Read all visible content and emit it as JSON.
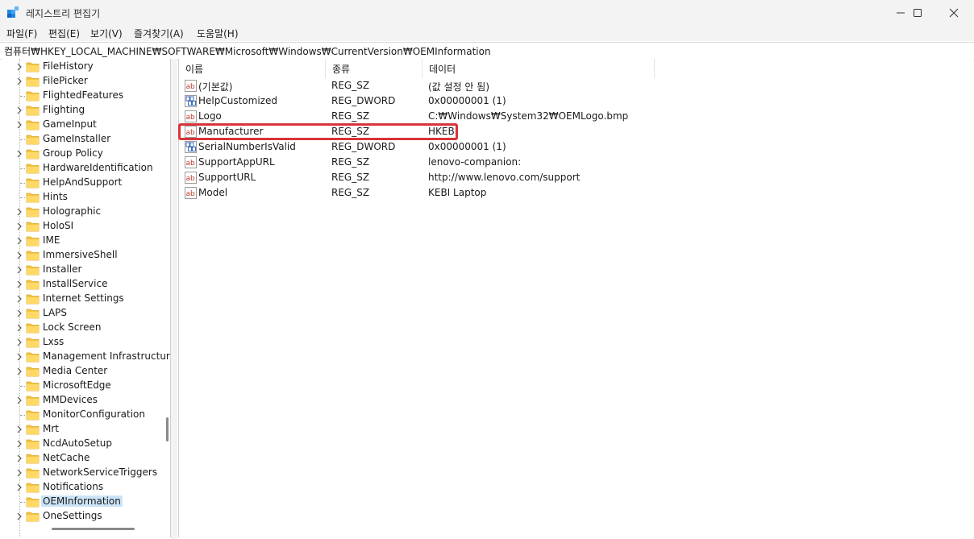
{
  "window": {
    "title": "레지스트리 편집기",
    "minimize_icon": "minimize-icon",
    "maximize_icon": "maximize-icon",
    "close_icon": "close-icon"
  },
  "menu": {
    "items": [
      "파일(F)",
      "편집(E)",
      "보기(V)",
      "즐겨찾기(A)",
      "도움말(H)"
    ]
  },
  "address": {
    "path": "컴퓨터₩HKEY_LOCAL_MACHINE₩SOFTWARE₩Microsoft₩Windows₩CurrentVersion₩OEMInformation"
  },
  "tree": {
    "items": [
      {
        "label": "FileHistory",
        "expandable": true
      },
      {
        "label": "FilePicker",
        "expandable": true
      },
      {
        "label": "FlightedFeatures",
        "expandable": false
      },
      {
        "label": "Flighting",
        "expandable": true
      },
      {
        "label": "GameInput",
        "expandable": true
      },
      {
        "label": "GameInstaller",
        "expandable": false
      },
      {
        "label": "Group Policy",
        "expandable": true
      },
      {
        "label": "HardwareIdentification",
        "expandable": false
      },
      {
        "label": "HelpAndSupport",
        "expandable": false
      },
      {
        "label": "Hints",
        "expandable": false
      },
      {
        "label": "Holographic",
        "expandable": true
      },
      {
        "label": "HoloSI",
        "expandable": true
      },
      {
        "label": "IME",
        "expandable": true
      },
      {
        "label": "ImmersiveShell",
        "expandable": true
      },
      {
        "label": "Installer",
        "expandable": true
      },
      {
        "label": "InstallService",
        "expandable": true
      },
      {
        "label": "Internet Settings",
        "expandable": true
      },
      {
        "label": "LAPS",
        "expandable": true
      },
      {
        "label": "Lock Screen",
        "expandable": true
      },
      {
        "label": "Lxss",
        "expandable": true
      },
      {
        "label": "Management Infrastructure",
        "expandable": true
      },
      {
        "label": "Media Center",
        "expandable": true
      },
      {
        "label": "MicrosoftEdge",
        "expandable": false
      },
      {
        "label": "MMDevices",
        "expandable": true
      },
      {
        "label": "MonitorConfiguration",
        "expandable": false
      },
      {
        "label": "Mrt",
        "expandable": true
      },
      {
        "label": "NcdAutoSetup",
        "expandable": true
      },
      {
        "label": "NetCache",
        "expandable": true
      },
      {
        "label": "NetworkServiceTriggers",
        "expandable": true
      },
      {
        "label": "Notifications",
        "expandable": true
      },
      {
        "label": "OEMInformation",
        "expandable": false,
        "selected": true
      },
      {
        "label": "OneSettings",
        "expandable": true
      }
    ]
  },
  "values": {
    "columns": [
      "이름",
      "종류",
      "데이터"
    ],
    "rows": [
      {
        "name": "(기본값)",
        "type": "REG_SZ",
        "data": "(값 설정 안 됨)",
        "icon": "string-value-icon"
      },
      {
        "name": "HelpCustomized",
        "type": "REG_DWORD",
        "data": "0x00000001 (1)",
        "icon": "binary-value-icon"
      },
      {
        "name": "Logo",
        "type": "REG_SZ",
        "data": "C:₩Windows₩System32₩OEMLogo.bmp",
        "icon": "string-value-icon"
      },
      {
        "name": "Manufacturer",
        "type": "REG_SZ",
        "data": "HKEBI",
        "icon": "string-value-icon"
      },
      {
        "name": "SerialNumberIsValid",
        "type": "REG_DWORD",
        "data": "0x00000001 (1)",
        "icon": "binary-value-icon"
      },
      {
        "name": "SupportAppURL",
        "type": "REG_SZ",
        "data": "lenovo-companion:",
        "icon": "string-value-icon"
      },
      {
        "name": "SupportURL",
        "type": "REG_SZ",
        "data": "http://www.lenovo.com/support",
        "icon": "string-value-icon"
      },
      {
        "name": "Model",
        "type": "REG_SZ",
        "data": "KEBI Laptop",
        "icon": "string-value-icon"
      }
    ]
  },
  "colors": {
    "highlight_border": "#d8343a",
    "selection": "#cce4f7",
    "folder": "#f4c542"
  }
}
